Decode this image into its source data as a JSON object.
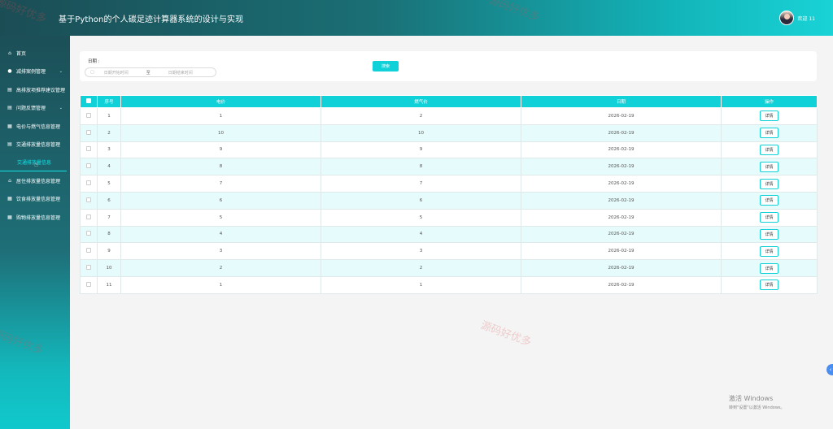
{
  "header": {
    "title": "基于Python的个人碳足迹计算器系统的设计与实现",
    "welcome": "欢迎 11"
  },
  "sidebar": {
    "items": [
      {
        "label": "首页",
        "icon": "home-icon",
        "glyph": "⌂",
        "chev": false
      },
      {
        "label": "减排案例管理",
        "icon": "circle-icon",
        "glyph": "●",
        "chev": true
      },
      {
        "label": "高排放项推荐建议管理",
        "icon": "list-icon",
        "glyph": "▤",
        "chev": false
      },
      {
        "label": "问题反馈管理",
        "icon": "list-icon",
        "glyph": "▤",
        "chev": true
      },
      {
        "label": "电价与燃气信息管理",
        "icon": "grid-icon",
        "glyph": "▦",
        "chev": false
      },
      {
        "label": "交通排放量信息管理",
        "icon": "list-icon",
        "glyph": "▤",
        "chev": false
      }
    ],
    "sub_item": "交通排放量信息",
    "items_after": [
      {
        "label": "居住排放量信息管理",
        "icon": "house-icon",
        "glyph": "⌂"
      },
      {
        "label": "饮食排放量信息管理",
        "icon": "grid-icon",
        "glyph": "▦"
      },
      {
        "label": "购物排放量信息管理",
        "icon": "grid-icon",
        "glyph": "▦"
      }
    ]
  },
  "search": {
    "date_label": "日期 :",
    "start_placeholder": "日期开始时间",
    "separator": "至",
    "end_placeholder": "日期结束时间",
    "button": "搜索"
  },
  "table": {
    "headers": [
      "序号",
      "电价",
      "燃气价",
      "日期",
      "操作"
    ],
    "rows": [
      [
        "1",
        "1",
        "2",
        "2026-02-19"
      ],
      [
        "2",
        "10",
        "10",
        "2026-02-19"
      ],
      [
        "3",
        "9",
        "9",
        "2026-02-19"
      ],
      [
        "4",
        "8",
        "8",
        "2026-02-19"
      ],
      [
        "5",
        "7",
        "7",
        "2026-02-19"
      ],
      [
        "6",
        "6",
        "6",
        "2026-02-19"
      ],
      [
        "7",
        "5",
        "5",
        "2026-02-19"
      ],
      [
        "8",
        "4",
        "4",
        "2026-02-19"
      ],
      [
        "9",
        "3",
        "3",
        "2026-02-19"
      ],
      [
        "10",
        "2",
        "2",
        "2026-02-19"
      ],
      [
        "11",
        "1",
        "1",
        "2026-02-19"
      ]
    ],
    "detail_label": "详情"
  },
  "watermark": "源码好优多",
  "windows": {
    "line1": "激活 Windows",
    "line2": "转到\"设置\"以激活 Windows。"
  },
  "colors": {
    "accent": "#10d0d8",
    "sidebar_top": "#1c4f57",
    "sidebar_bottom": "#10c9cc"
  }
}
